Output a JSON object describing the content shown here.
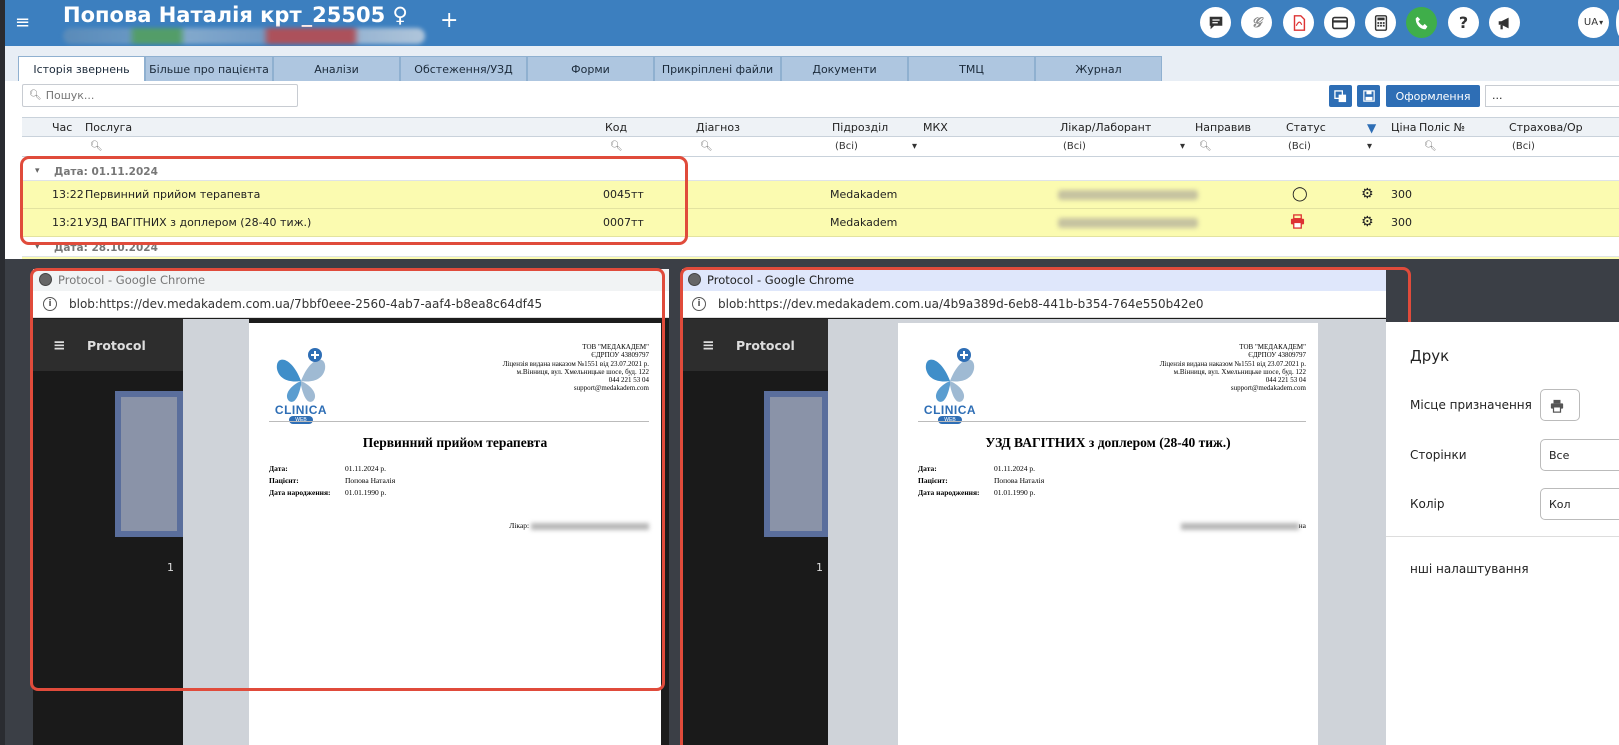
{
  "header": {
    "patient_title": "Попова Наталія крт_25505",
    "gender_symbol": "♀",
    "add_label": "+",
    "lang": "UA"
  },
  "tabs": [
    {
      "label": "Історія звернень"
    },
    {
      "label": "Більше про пацієнта"
    },
    {
      "label": "Аналізи"
    },
    {
      "label": "Обстеження/УЗД"
    },
    {
      "label": "Форми"
    },
    {
      "label": "Прикріплені файли"
    },
    {
      "label": "Документи"
    },
    {
      "label": "ТМЦ"
    },
    {
      "label": "Журнал"
    }
  ],
  "toolbar": {
    "search_placeholder": "Пошук...",
    "oform_label": "Оформлення",
    "more_value": "..."
  },
  "grid": {
    "columns": [
      "Час",
      "Послуга",
      "Код",
      "Діагноз",
      "Підрозділ",
      "МКХ",
      "Лікар/Лаборант",
      "Направив",
      "Статус",
      "Ціна",
      "Поліс №",
      "Страхова/Ор"
    ],
    "filter_all": "(Всі)",
    "groups": [
      {
        "date_label": "Дата: 01.11.2024",
        "rows": [
          {
            "time": "13:22",
            "service": "Первинний прийом терапевта",
            "code": "0045тт",
            "department": "Medakadem",
            "price": "300"
          },
          {
            "time": "13:21",
            "service": "УЗД ВАГІТНИХ з доплером (28-40 тиж.)",
            "code": "0007тт",
            "department": "Medakadem",
            "price": "300"
          }
        ]
      },
      {
        "date_label": "Дата: 28.10.2024",
        "rows": []
      }
    ]
  },
  "windows": [
    {
      "title": "Protocol - Google Chrome",
      "url": "blob:https://dev.medakadem.com.ua/7bbf0eee-2560-4ab7-aaf4-b8ea8c64df45",
      "viewer_title": "Protocol",
      "page_number": "1",
      "doc_title": "Первинний прийом терапевта",
      "doctor_label": "Лікар:"
    },
    {
      "title": "Protocol - Google Chrome",
      "url": "blob:https://dev.medakadem.com.ua/4b9a389d-6eb8-441b-b354-764e550b42e0",
      "viewer_title": "Protocol",
      "page_number": "1",
      "doc_title": "УЗД ВАГІТНИХ з доплером (28-40 тиж.)",
      "doctor_suffix": "на"
    }
  ],
  "document": {
    "org_lines": [
      "ТОВ \"МЕДАКАДЕМ\"",
      "ЄДРПОУ 43809797",
      "Ліцензія видана наказом №1551 від 23.07.2021 р.",
      "м.Вінниця, вул. Хмельницьке шосе, буд. 122",
      "044 221 53 04",
      "support@medakadem.com"
    ],
    "logo_text": "CLINICA",
    "logo_sub": "WEB",
    "fields": [
      {
        "label": "Дата:",
        "value": "01.11.2024 р."
      },
      {
        "label": "Пацієнт:",
        "value": "Попова Наталія"
      },
      {
        "label": "Дата народження:",
        "value": "01.01.1990 р."
      }
    ]
  },
  "print_panel": {
    "title": "Друк",
    "destination_label": "Місце призначення",
    "pages_label": "Сторінки",
    "pages_value": "Все",
    "color_label": "Колір",
    "color_value": "Кол",
    "more_settings": "нші налаштування"
  },
  "colors": {
    "header_bg": "#3c7fbf",
    "row_highlight": "#fbfbb0",
    "annotation": "#e04b3b",
    "button_blue": "#2e6eb5"
  }
}
